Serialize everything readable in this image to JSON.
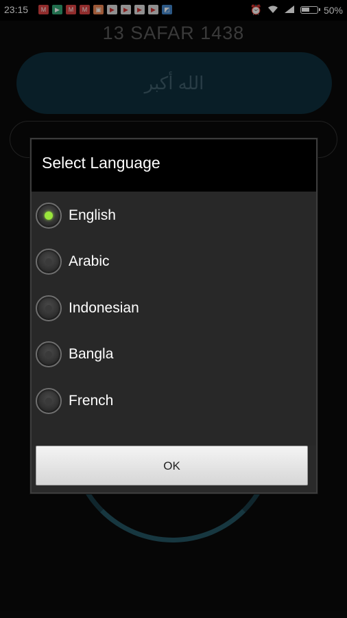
{
  "status_bar": {
    "time": "23:15",
    "battery": "50%",
    "notification_icons": [
      "gmail-icon",
      "google-play-icon",
      "gmail-icon",
      "gmail-icon",
      "shop-icon",
      "play-store-icon",
      "play-store-icon",
      "play-store-icon",
      "play-store-icon",
      "photo-icon"
    ],
    "system_icons": [
      "alarm-icon",
      "wifi-icon",
      "signal-icon",
      "battery-icon"
    ]
  },
  "background": {
    "date": "13 SAFAR 1438",
    "takbir": "الله أكبر"
  },
  "dialog": {
    "title": "Select Language",
    "options": [
      {
        "label": "English",
        "checked": true
      },
      {
        "label": "Arabic",
        "checked": false
      },
      {
        "label": "Indonesian",
        "checked": false
      },
      {
        "label": "Bangla",
        "checked": false
      },
      {
        "label": "French",
        "checked": false
      }
    ],
    "ok_label": "OK"
  },
  "colors": {
    "accent_radio": "#9ae63c",
    "takbir_pill": "#0e2f3c",
    "ring": "#245563"
  }
}
